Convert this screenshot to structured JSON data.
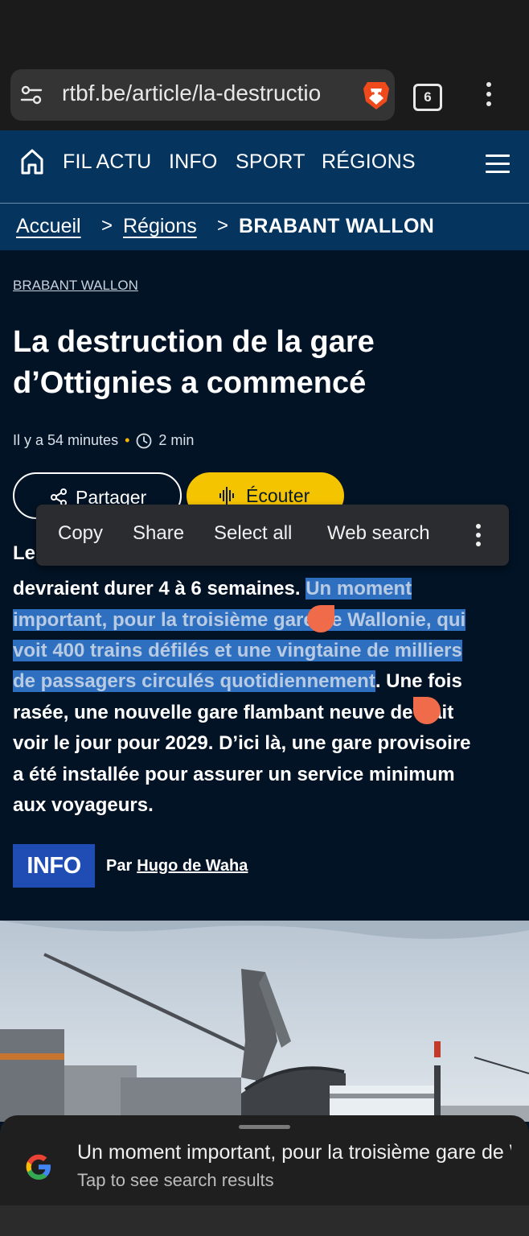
{
  "browser": {
    "url": "rtbf.be/article/la-destructio",
    "tab_count": "6"
  },
  "nav": {
    "items": [
      "FIL ACTU",
      "INFO",
      "SPORT",
      "RÉGIONS"
    ]
  },
  "breadcrumb": {
    "home": "Accueil",
    "regions": "Régions",
    "current": "BRABANT WALLON",
    "separator": ">"
  },
  "article": {
    "category": "BRABANT WALLON",
    "title": "La destruction de la gare d’Ottignies a commencé",
    "time_ago": "Il y a 54 minutes",
    "dot": "•",
    "read_time": "2 min",
    "share_label": "Partager",
    "listen_label": "Écouter",
    "body": {
      "line1": "Les",
      "line2_plain": "devraient durer 4 à 6 semaines. ",
      "line2_sel": "Un moment",
      "line3_sel": "important, pour la troisième gare de Wallonie, qui",
      "line4_sel": "voit 400 trains défilés et une vingtaine de milliers",
      "line5_sel": "de passagers circulés quotidiennement",
      "line5_plain": ". Une fois",
      "line6": "rasée, une nouvelle gare flambant neuve devrait",
      "line7": "voir le jour pour 2029. D’ici là, une gare provisoire",
      "line8": "a été installée pour assurer un service minimum",
      "line9": "aux voyageurs."
    },
    "byline_logo": "INFO",
    "byline_prefix": "Par",
    "author": "Hugo de Waha"
  },
  "context_menu": {
    "copy": "Copy",
    "share": "Share",
    "select_all": "Select all",
    "web_search": "Web search"
  },
  "search_sheet": {
    "title": "Un moment important, pour la troisième gare de Wallonie…",
    "subtitle": "Tap to see search results"
  },
  "colors": {
    "nav_bg": "#05355f",
    "page_bg": "#021325",
    "accent_yellow": "#f5c400",
    "selection": "#2e6fbf",
    "selection_handle": "#f06b4a"
  }
}
